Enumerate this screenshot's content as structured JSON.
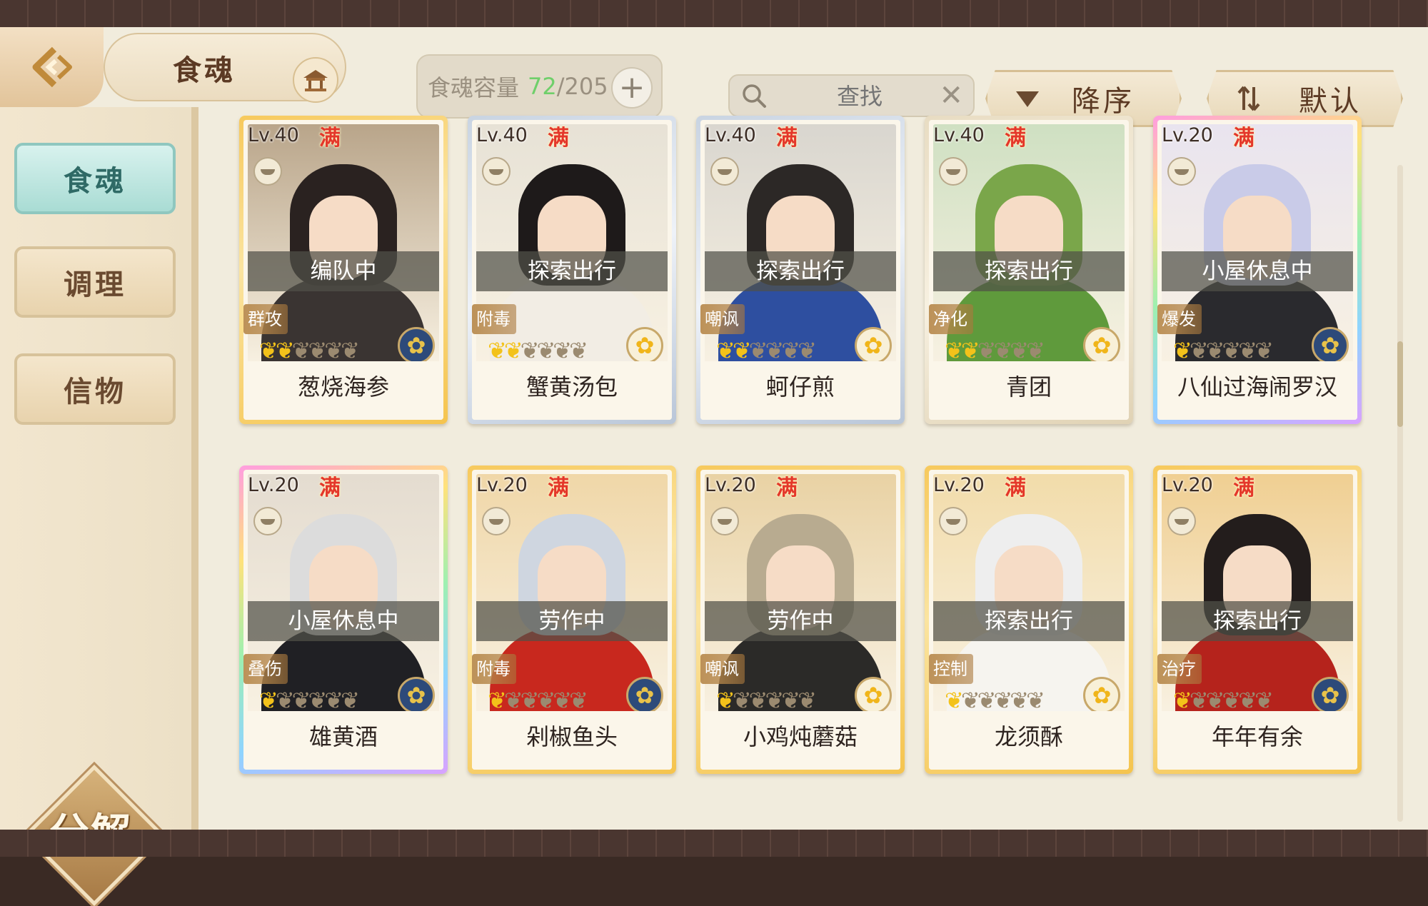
{
  "header": {
    "title": "食魂",
    "capacity_label": "食魂容量",
    "capacity_current": "72",
    "capacity_max": "/205",
    "search_placeholder": "查找",
    "sort_order_label": "降序",
    "sort_mode_label": "默认"
  },
  "sidebar": {
    "items": [
      {
        "label": "食魂",
        "active": true
      },
      {
        "label": "调理",
        "active": false
      },
      {
        "label": "信物",
        "active": false
      }
    ],
    "decompose_label": "分解"
  },
  "colors": {
    "flame_active": "#f3c21a",
    "flame_inactive": "#9b8a70",
    "capacity_current": "#6fcf6a",
    "active_tab": "#a9dcd4"
  },
  "cards": [
    {
      "level": "Lv.40",
      "full": "满",
      "status": "编队中",
      "role": "群攻",
      "flames_lit": 2,
      "name": "葱烧海参",
      "frame": "gold",
      "emblem": "blue",
      "hair": "#2a2220",
      "outfit": "#3a3432",
      "bg": "#b9a58a"
    },
    {
      "level": "Lv.40",
      "full": "满",
      "status": "探索出行",
      "role": "附毒",
      "flames_lit": 2,
      "name": "蟹黄汤包",
      "frame": "silver",
      "emblem": "gold",
      "hair": "#1e1a1a",
      "outfit": "#f2ede4",
      "bg": "#e7e2d6"
    },
    {
      "level": "Lv.40",
      "full": "满",
      "status": "探索出行",
      "role": "嘲讽",
      "flames_lit": 2,
      "name": "蚵仔煎",
      "frame": "silver",
      "emblem": "gold",
      "hair": "#2c2826",
      "outfit": "#2e4fa0",
      "bg": "#d9d6cf"
    },
    {
      "level": "Lv.40",
      "full": "满",
      "status": "探索出行",
      "role": "净化",
      "flames_lit": 2,
      "name": "青团",
      "frame": "plain",
      "emblem": "gold",
      "hair": "#7aa64a",
      "outfit": "#5f9a3c",
      "bg": "#cfe0c2"
    },
    {
      "level": "Lv.20",
      "full": "满",
      "status": "小屋休息中",
      "role": "爆发",
      "flames_lit": 1,
      "name": "八仙过海闹罗汉",
      "frame": "rainbow",
      "emblem": "blue",
      "hair": "#c9cbe8",
      "outfit": "#2a2a2e",
      "bg": "#e9e4ef"
    },
    {
      "level": "Lv.20",
      "full": "满",
      "status": "小屋休息中",
      "role": "叠伤",
      "flames_lit": 1,
      "name": "雄黄酒",
      "frame": "rainbow",
      "emblem": "blue",
      "hair": "#dcdcdc",
      "outfit": "#202024",
      "bg": "#e4dcd0"
    },
    {
      "level": "Lv.20",
      "full": "满",
      "status": "劳作中",
      "role": "附毒",
      "flames_lit": 1,
      "name": "剁椒鱼头",
      "frame": "gold",
      "emblem": "blue",
      "hair": "#cfd6e0",
      "outfit": "#c8281e",
      "bg": "#f0d7a8"
    },
    {
      "level": "Lv.20",
      "full": "满",
      "status": "劳作中",
      "role": "嘲讽",
      "flames_lit": 1,
      "name": "小鸡炖蘑菇",
      "frame": "gold",
      "emblem": "gold",
      "hair": "#b8ab90",
      "outfit": "#2b2a28",
      "bg": "#e9d2a4"
    },
    {
      "level": "Lv.20",
      "full": "满",
      "status": "探索出行",
      "role": "控制",
      "flames_lit": 1,
      "name": "龙须酥",
      "frame": "gold",
      "emblem": "gold",
      "hair": "#eeeeee",
      "outfit": "#f6f4ef",
      "bg": "#f2dcaa"
    },
    {
      "level": "Lv.20",
      "full": "满",
      "status": "探索出行",
      "role": "治疗",
      "flames_lit": 1,
      "name": "年年有余",
      "frame": "gold",
      "emblem": "blue",
      "hair": "#231d1c",
      "outfit": "#b5231c",
      "bg": "#f0cf92"
    }
  ]
}
